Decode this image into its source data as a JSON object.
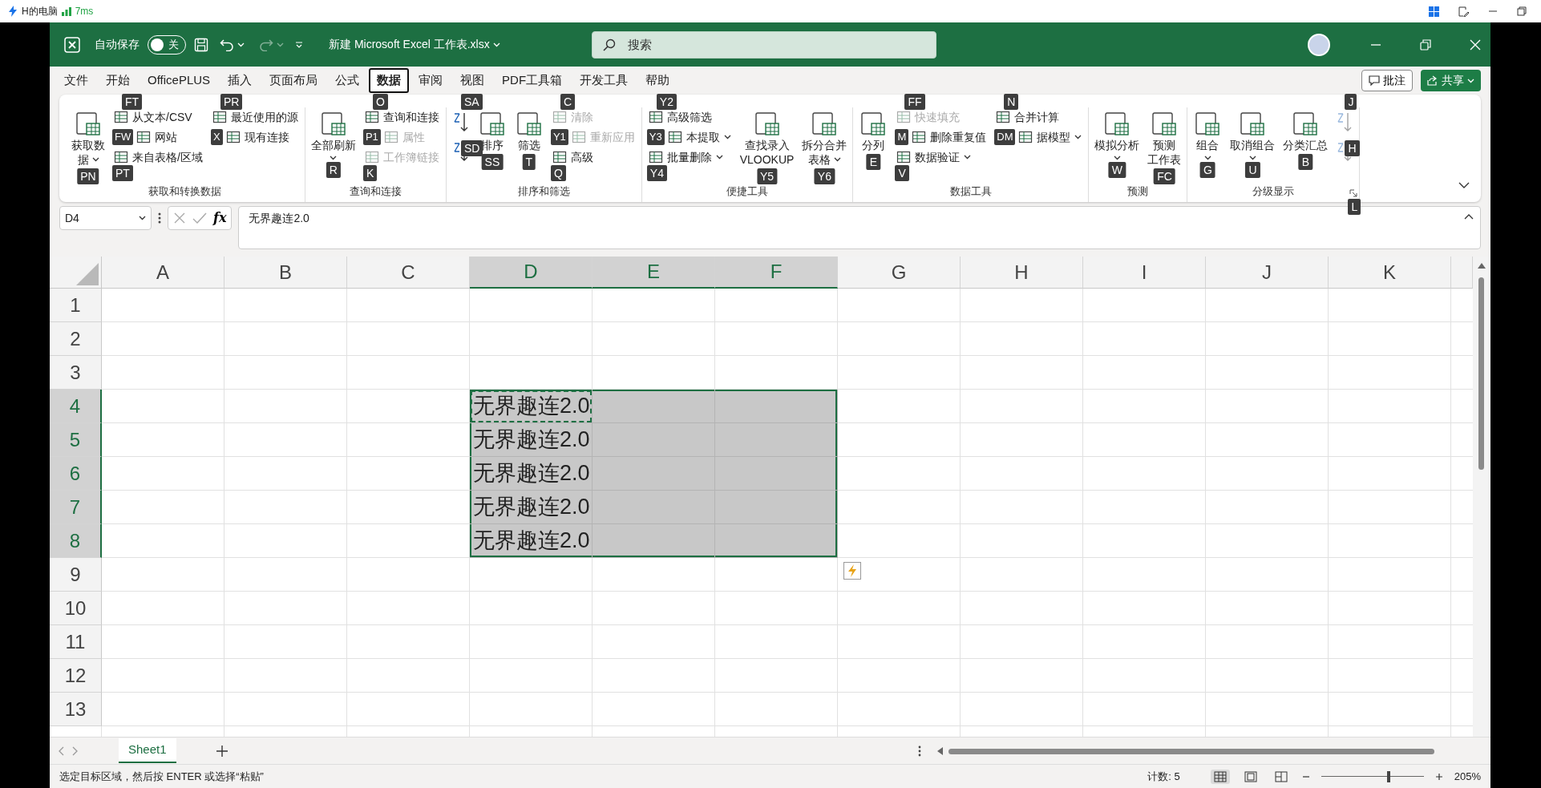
{
  "remote_session": {
    "computer": "H的电脑",
    "latency": "7ms"
  },
  "title_bar": {
    "autosave_label": "自动保存",
    "autosave": {
      "on": false,
      "label": "关"
    },
    "filename": "新建 Microsoft Excel 工作表.xlsx",
    "search": {
      "placeholder": "搜索"
    }
  },
  "menu_tabs": [
    {
      "label": "文件",
      "selected": false
    },
    {
      "label": "开始",
      "selected": false
    },
    {
      "label": "OfficePLUS",
      "selected": false
    },
    {
      "label": "插入",
      "selected": false
    },
    {
      "label": "页面布局",
      "selected": false
    },
    {
      "label": "公式",
      "selected": false
    },
    {
      "label": "数据",
      "selected": true
    },
    {
      "label": "审阅",
      "selected": false
    },
    {
      "label": "视图",
      "selected": false
    },
    {
      "label": "PDF工具箱",
      "selected": false
    },
    {
      "label": "开发工具",
      "selected": false
    },
    {
      "label": "帮助",
      "selected": false
    }
  ],
  "ribbon_actions": {
    "comments": "批注",
    "share": "共享"
  },
  "ribbon_groups": [
    {
      "label": "获取和转换数据",
      "columns": [
        [
          {
            "kind": "large",
            "lines": [
              "获取数",
              "据"
            ],
            "dropdown": true,
            "disabled": false,
            "keytip": "PN"
          }
        ],
        [
          {
            "kind": "small",
            "label": "从文本/CSV",
            "dropdown": false,
            "disabled": false,
            "keytip": "FT"
          },
          {
            "kind": "small",
            "label": "网站",
            "dropdown": false,
            "disabled": false,
            "keytip": "FW"
          },
          {
            "kind": "small",
            "label": "来自表格/区域",
            "dropdown": false,
            "disabled": false,
            "keytip": "PT"
          }
        ],
        [
          {
            "kind": "small",
            "label": "最近使用的源",
            "dropdown": false,
            "disabled": false,
            "keytip": "PR"
          },
          {
            "kind": "small",
            "label": "现有连接",
            "dropdown": false,
            "disabled": false,
            "keytip": "X"
          }
        ]
      ]
    },
    {
      "label": "查询和连接",
      "columns": [
        [
          {
            "kind": "large",
            "lines": [
              "全部刷新"
            ],
            "dropdown": true,
            "disabled": false,
            "keytip": "R"
          }
        ],
        [
          {
            "kind": "small",
            "label": "查询和连接",
            "dropdown": false,
            "disabled": false,
            "keytip": "O"
          },
          {
            "kind": "small",
            "label": "属性",
            "dropdown": false,
            "disabled": true,
            "keytip": "P1"
          },
          {
            "kind": "small",
            "label": "工作簿链接",
            "dropdown": false,
            "disabled": true,
            "keytip": "K"
          }
        ]
      ]
    },
    {
      "label": "排序和筛选",
      "columns": [
        [
          {
            "kind": "icon",
            "disabled": false,
            "keytip": "SA"
          },
          {
            "kind": "icon",
            "disabled": false,
            "keytip": "SD"
          }
        ],
        [
          {
            "kind": "large",
            "lines": [
              "排序"
            ],
            "dropdown": false,
            "disabled": false,
            "keytip": "SS"
          }
        ],
        [
          {
            "kind": "large",
            "lines": [
              "筛选"
            ],
            "dropdown": false,
            "disabled": false,
            "keytip": "T"
          }
        ],
        [
          {
            "kind": "small",
            "label": "清除",
            "dropdown": false,
            "disabled": true,
            "keytip": "C"
          },
          {
            "kind": "small",
            "label": "重新应用",
            "dropdown": false,
            "disabled": true,
            "keytip": "Y1"
          },
          {
            "kind": "small",
            "label": "高级",
            "dropdown": false,
            "disabled": false,
            "keytip": "Q"
          }
        ]
      ]
    },
    {
      "label": "便捷工具",
      "columns": [
        [
          {
            "kind": "small",
            "label": "高级筛选",
            "dropdown": false,
            "disabled": false,
            "keytip": "Y2"
          },
          {
            "kind": "small",
            "label": "本提取",
            "dropdown": true,
            "disabled": false,
            "keytip": "Y3"
          },
          {
            "kind": "small",
            "label": "批量删除",
            "dropdown": true,
            "disabled": false,
            "keytip": "Y4"
          }
        ],
        [
          {
            "kind": "large",
            "lines": [
              "查找录入",
              "VLOOKUP"
            ],
            "dropdown": false,
            "disabled": false,
            "keytip": "Y5"
          }
        ],
        [
          {
            "kind": "large",
            "lines": [
              "拆分合并",
              "表格"
            ],
            "dropdown": true,
            "disabled": false,
            "keytip": "Y6"
          }
        ]
      ]
    },
    {
      "label": "数据工具",
      "columns": [
        [
          {
            "kind": "large",
            "lines": [
              "分列"
            ],
            "dropdown": false,
            "disabled": false,
            "keytip": "E"
          }
        ],
        [
          {
            "kind": "small",
            "label": "快速填充",
            "dropdown": false,
            "disabled": true,
            "keytip": "FF"
          },
          {
            "kind": "small",
            "label": "删除重复值",
            "dropdown": false,
            "disabled": false,
            "keytip": "M"
          },
          {
            "kind": "small",
            "label": "数据验证",
            "dropdown": true,
            "disabled": false,
            "keytip": "V"
          }
        ],
        [
          {
            "kind": "small",
            "label": "合并计算",
            "dropdown": false,
            "disabled": false,
            "keytip": "N"
          },
          {
            "kind": "small",
            "label": "据模型",
            "dropdown": true,
            "disabled": false,
            "keytip": "DM"
          }
        ]
      ]
    },
    {
      "label": "预测",
      "columns": [
        [
          {
            "kind": "large",
            "lines": [
              "模拟分析"
            ],
            "dropdown": true,
            "disabled": false,
            "keytip": "W"
          }
        ],
        [
          {
            "kind": "large",
            "lines": [
              "预测",
              "工作表"
            ],
            "dropdown": false,
            "disabled": false,
            "keytip": "FC"
          }
        ]
      ]
    },
    {
      "label": "分级显示",
      "launcher_keytip": "L",
      "columns": [
        [
          {
            "kind": "large",
            "lines": [
              "组合"
            ],
            "dropdown": true,
            "disabled": false,
            "keytip": "G"
          }
        ],
        [
          {
            "kind": "large",
            "lines": [
              "取消组合"
            ],
            "dropdown": true,
            "disabled": false,
            "keytip": "U"
          }
        ],
        [
          {
            "kind": "large",
            "lines": [
              "分类汇总"
            ],
            "dropdown": false,
            "disabled": false,
            "keytip": "B"
          }
        ],
        [
          {
            "kind": "icon",
            "disabled": true,
            "keytip": "J"
          },
          {
            "kind": "icon",
            "disabled": true,
            "keytip": "H"
          }
        ]
      ]
    }
  ],
  "formula_bar": {
    "name_box": "D4",
    "function_label": "fx",
    "formula": "无界趣连2.0"
  },
  "sheet": {
    "columns": [
      {
        "label": "A",
        "selected": false
      },
      {
        "label": "B",
        "selected": false
      },
      {
        "label": "C",
        "selected": false
      },
      {
        "label": "D",
        "selected": true
      },
      {
        "label": "E",
        "selected": true
      },
      {
        "label": "F",
        "selected": true
      },
      {
        "label": "G",
        "selected": false
      },
      {
        "label": "H",
        "selected": false
      },
      {
        "label": "I",
        "selected": false
      },
      {
        "label": "J",
        "selected": false
      },
      {
        "label": "K",
        "selected": false
      }
    ],
    "rows": [
      {
        "label": "1",
        "selected": false
      },
      {
        "label": "2",
        "selected": false
      },
      {
        "label": "3",
        "selected": false
      },
      {
        "label": "4",
        "selected": true,
        "cells": [
          null,
          null,
          null,
          {
            "text": "无界趣连2.0",
            "selected": true,
            "copied": true
          },
          {
            "selected": true,
            "copied": false
          },
          {
            "selected": true,
            "copied": false
          }
        ]
      },
      {
        "label": "5",
        "selected": true,
        "cells": [
          null,
          null,
          null,
          {
            "text": "无界趣连2.0",
            "selected": true,
            "copied": false
          },
          {
            "selected": true,
            "copied": false
          },
          {
            "selected": true,
            "copied": false
          }
        ]
      },
      {
        "label": "6",
        "selected": true,
        "cells": [
          null,
          null,
          null,
          {
            "text": "无界趣连2.0",
            "selected": true,
            "copied": false
          },
          {
            "selected": true,
            "copied": false
          },
          {
            "selected": true,
            "copied": false
          }
        ]
      },
      {
        "label": "7",
        "selected": true,
        "cells": [
          null,
          null,
          null,
          {
            "text": "无界趣连2.0",
            "selected": true,
            "copied": false
          },
          {
            "selected": true,
            "copied": false
          },
          {
            "selected": true,
            "copied": false
          }
        ]
      },
      {
        "label": "8",
        "selected": true,
        "cells": [
          null,
          null,
          null,
          {
            "text": "无界趣连2.0",
            "selected": true,
            "copied": false
          },
          {
            "selected": true,
            "copied": false
          },
          {
            "selected": true,
            "copied": false
          }
        ]
      },
      {
        "label": "9",
        "selected": false
      },
      {
        "label": "10",
        "selected": false
      },
      {
        "label": "11",
        "selected": false
      },
      {
        "label": "12",
        "selected": false
      },
      {
        "label": "13",
        "selected": false
      }
    ]
  },
  "sheet_tabs": [
    {
      "label": "Sheet1",
      "selected": true
    }
  ],
  "status_bar": {
    "message": "选定目标区域，然后按 ENTER 或选择“粘贴”",
    "count": "计数: 5",
    "views": [
      {
        "kind": "normal",
        "selected": true
      },
      {
        "kind": "page-layout",
        "selected": false
      },
      {
        "kind": "page-break",
        "selected": false
      }
    ],
    "zoom": {
      "level": 0.66,
      "reading": "205%"
    }
  }
}
